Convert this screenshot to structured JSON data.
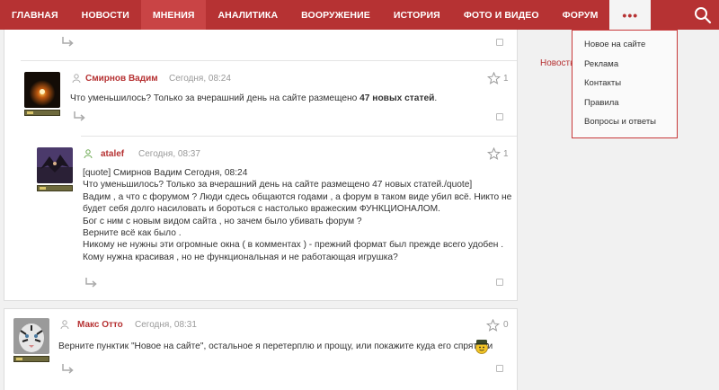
{
  "nav": {
    "items": [
      "ГЛАВНАЯ",
      "НОВОСТИ",
      "МНЕНИЯ",
      "АНАЛИТИКА",
      "ВООРУЖЕНИЕ",
      "ИСТОРИЯ",
      "ФОТО И ВИДЕО",
      "ФОРУМ"
    ],
    "active_index": 2,
    "more_label": "•••"
  },
  "dropdown": {
    "items": [
      "Новое на сайте",
      "Реклама",
      "Контакты",
      "Правила",
      "Вопросы и ответы"
    ]
  },
  "side_link": "Новость",
  "comments": [
    {
      "author": "Смирнов Вадим",
      "time": "Сегодня, 08:24",
      "likes": "1",
      "text_before": "Что уменьшилось? Только за вчерашний день на сайте размещено ",
      "text_bold": "47 новых статей",
      "text_after": "."
    },
    {
      "author": "atalef",
      "time": "Сегодня, 08:37",
      "likes": "1",
      "lines": [
        "[quote] Смирнов Вадим Сегодня, 08:24",
        "Что уменьшилось? Только за вчерашний день на сайте размещено 47 новых статей./quote]",
        "Вадим , а что с форумом ? Люди сдесь общаются годами , а форум в таком виде убил всё. Никто не",
        "будет себя долго насиловать и бороться с настолько вражеским ФУНКЦИОНАЛОМ.",
        "Бог с ним с новым видом сайта , но зачем было убивать форум ?",
        "Верните всё как было .",
        "Никому не нужны эти огромные окна ( в комментах ) - прежний формат был прежде всего удобен .",
        "Кому нужна красивая , но не функциональная и не работающая игрушка?"
      ]
    },
    {
      "author": "Макс Отто",
      "time": "Сегодня, 08:31",
      "likes": "0",
      "text": "Верните пунктик \"Новое на сайте\", остальное я перетерплю и прощу, или покажите куда его спрятали"
    }
  ],
  "colors": {
    "brand": "#b63233",
    "nav_active": "#c94445",
    "background": "#f1f1f1"
  },
  "icons": [
    "search-icon",
    "reply-icon",
    "user-icon",
    "star-icon",
    "checkbox",
    "smiley-icon"
  ]
}
